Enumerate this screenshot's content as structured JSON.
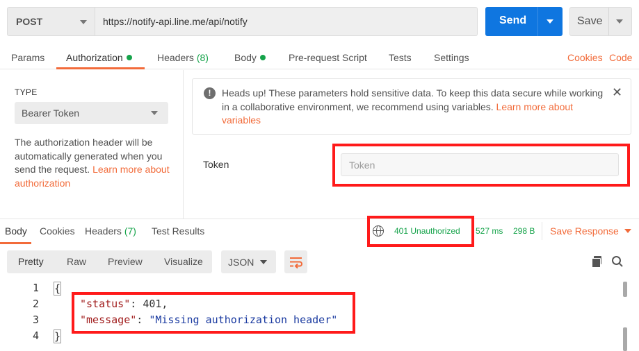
{
  "request": {
    "method": "POST",
    "url": "https://notify-api.line.me/api/notify",
    "send_label": "Send",
    "save_label": "Save"
  },
  "request_tabs": [
    {
      "label": "Params"
    },
    {
      "label": "Authorization"
    },
    {
      "label": "Headers",
      "count": "(8)"
    },
    {
      "label": "Body"
    },
    {
      "label": "Pre-request Script"
    },
    {
      "label": "Tests"
    },
    {
      "label": "Settings"
    }
  ],
  "request_links": {
    "cookies": "Cookies",
    "code": "Code"
  },
  "auth": {
    "type_label": "TYPE",
    "type_value": "Bearer Token",
    "description": "The authorization header will be automatically generated when you send the request. ",
    "description_link": "Learn more about authorization",
    "alert_text": "Heads up! These parameters hold sensitive data. To keep this data secure while working in a collaborative environment, we recommend using variables. ",
    "alert_link": "Learn more about variables",
    "token_label": "Token",
    "token_placeholder": "Token",
    "token_value": ""
  },
  "response_tabs": [
    {
      "label": "Body"
    },
    {
      "label": "Cookies"
    },
    {
      "label": "Headers",
      "count": "(7)"
    },
    {
      "label": "Test Results"
    }
  ],
  "response_meta": {
    "status": "401 Unauthorized",
    "time": "527 ms",
    "size": "298 B",
    "save_response": "Save Response"
  },
  "response_view": {
    "buttons": [
      "Pretty",
      "Raw",
      "Preview",
      "Visualize"
    ],
    "format": "JSON"
  },
  "response_body": {
    "line_numbers": [
      "1",
      "2",
      "3",
      "4"
    ],
    "open_brace": "{",
    "close_brace": "}",
    "fields": [
      {
        "key": "\"status\"",
        "colon": ": ",
        "value": "401",
        "trail": ","
      },
      {
        "key": "\"message\"",
        "colon": ": ",
        "value": "\"Missing authorization header\"",
        "trail": ""
      }
    ]
  },
  "colors": {
    "accent": "#f26b3a",
    "send": "#0f76e0",
    "success": "#15a34a",
    "highlight": "#ff1a1a"
  },
  "icons": [
    "chevron-down-icon",
    "close-icon",
    "info-icon",
    "globe-icon",
    "wrap-lines-icon",
    "copy-icon",
    "search-icon"
  ]
}
